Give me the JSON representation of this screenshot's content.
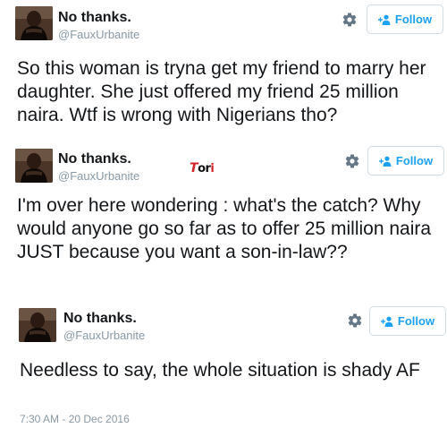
{
  "tweets": [
    {
      "name": "No thanks.",
      "handle": "@FauxUrbanite",
      "follow_label": "Follow",
      "text": "So this woman is tryna get my friend to marry her daughter. She just offered my friend 25 million naira. Wtf is wrong with Nigerians tho?"
    },
    {
      "name": "No thanks.",
      "handle": "@FauxUrbanite",
      "follow_label": "Follow",
      "text": "I'm over here wondering : what's the catch? Why would anyone go so far as to offer 25 million naira JUST because you want a son-in-law??",
      "watermark": "Tori"
    },
    {
      "name": "No thanks.",
      "handle": "@FauxUrbanite",
      "follow_label": "Follow",
      "text": "Needless to say, the whole situation is shady AF",
      "timestamp": "7:30 AM - 20 Dec 2016"
    }
  ],
  "colors": {
    "accent": "#1da1f2",
    "muted": "#8899a6",
    "text": "#14171a",
    "border": "#e1e8ed",
    "watermark_red": "#d4252b"
  },
  "icons": {
    "settings": "gear-icon",
    "follow": "add-user-icon"
  }
}
